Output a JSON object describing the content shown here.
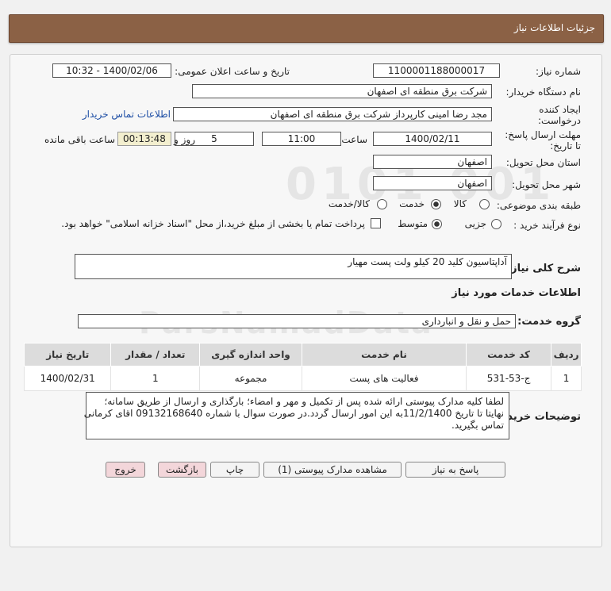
{
  "header": {
    "title": "جزئیات اطلاعات نیاز"
  },
  "form": {
    "need_number_label": "شماره نیاز:",
    "need_number": "1100001188000017",
    "announce_label": "تاریخ و ساعت اعلان عمومی:",
    "announce_value": "1400/02/06 - 10:32",
    "buyer_org_label": "نام دستگاه خریدار:",
    "buyer_org": "شرکت برق منطقه ای اصفهان",
    "creator_label_1": "ایجاد کننده",
    "creator_label_2": "درخواست:",
    "creator": "مجد رضا امینی کارپرداز شرکت برق منطقه ای اصفهان",
    "buyer_contact_link": "اطلاعات تماس خریدار",
    "deadline_label_1": "مهلت ارسال پاسخ:",
    "deadline_label_2": "تا تاریخ:",
    "deadline_date": "1400/02/11",
    "time_label": "ساعت",
    "deadline_time": "11:00",
    "days_value": "5",
    "days_label": "روز و",
    "remaining_time": "00:13:48",
    "remaining_label": "ساعت باقی مانده",
    "province_label": "استان محل تحویل:",
    "province": "اصفهان",
    "city_label": "شهر محل تحویل:",
    "city": "اصفهان",
    "category_label": "طبقه بندی موضوعی:",
    "category_options": [
      "کالا",
      "خدمت",
      "کالا/خدمت"
    ],
    "category_selected": "خدمت",
    "process_label": "نوع فرآیند خرید :",
    "process_options": [
      "جزیی",
      "متوسط"
    ],
    "process_selected": "متوسط",
    "payment_note": "پرداخت تمام یا بخشی از مبلغ خرید،از محل \"اسناد خزانه اسلامی\" خواهد بود."
  },
  "summary": {
    "label": "شرح کلی نیاز:",
    "value": "آداپتاسیون کلید 20 کیلو ولت پست مهیار"
  },
  "services": {
    "section_title": "اطلاعات خدمات مورد نیاز",
    "group_label": "گروه خدمت:",
    "group_value": "حمل و نقل و انبارداری"
  },
  "table": {
    "headers": [
      "ردیف",
      "کد خدمت",
      "نام خدمت",
      "واحد اندازه گیری",
      "تعداد / مقدار",
      "تاریخ نیاز"
    ],
    "rows": [
      [
        "1",
        "ج-53-531",
        "فعالیت های پست",
        "مجموعه",
        "1",
        "1400/02/31"
      ]
    ]
  },
  "buyer_notes": {
    "label": "توضیحات خریدار:",
    "lines": [
      "لطفا کلیه مدارک پیوستی ارائه شده  پس از تکمیل و مهر و امضاء؛ بارگذاری و ارسال از طریق سامانه؛",
      "نهایتا تا تاریخ 11/2/1400به این امور ارسال گردد.در صورت سوال با شماره 09132168640 اقای کرمانی",
      "تماس بگیرید."
    ]
  },
  "buttons": {
    "reply": "پاسخ به نیاز",
    "attachments": "مشاهده مدارک پیوستی (1)",
    "print": "چاپ",
    "back": "بازگشت",
    "exit": "خروج"
  },
  "watermark": {
    "brand": "ParsNamadData",
    "digits": "0101 001"
  }
}
